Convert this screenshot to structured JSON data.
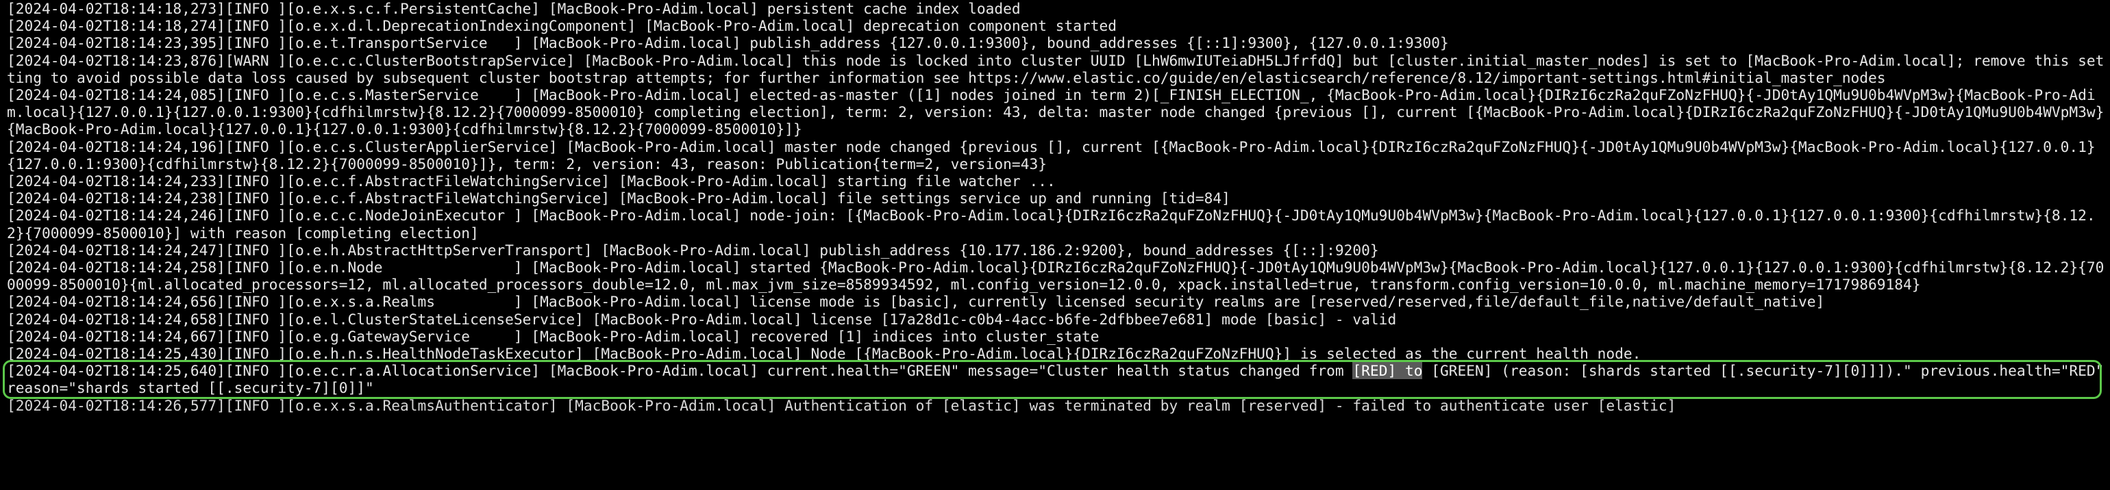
{
  "log": {
    "lines": [
      "[2024-04-02T18:14:18,273][INFO ][o.e.x.s.c.f.PersistentCache] [MacBook-Pro-Adim.local] persistent cache index loaded",
      "[2024-04-02T18:14:18,274][INFO ][o.e.x.d.l.DeprecationIndexingComponent] [MacBook-Pro-Adim.local] deprecation component started",
      "[2024-04-02T18:14:23,395][INFO ][o.e.t.TransportService   ] [MacBook-Pro-Adim.local] publish_address {127.0.0.1:9300}, bound_addresses {[::1]:9300}, {127.0.0.1:9300}",
      "[2024-04-02T18:14:23,876][WARN ][o.e.c.c.ClusterBootstrapService] [MacBook-Pro-Adim.local] this node is locked into cluster UUID [LhW6mwIUTeiaDH5LJfrfdQ] but [cluster.initial_master_nodes] is set to [MacBook-Pro-Adim.local]; remove this setting to avoid possible data loss caused by subsequent cluster bootstrap attempts; for further information see https://www.elastic.co/guide/en/elasticsearch/reference/8.12/important-settings.html#initial_master_nodes",
      "[2024-04-02T18:14:24,085][INFO ][o.e.c.s.MasterService    ] [MacBook-Pro-Adim.local] elected-as-master ([1] nodes joined in term 2)[_FINISH_ELECTION_, {MacBook-Pro-Adim.local}{DIRzI6czRa2quFZoNzFHUQ}{-JD0tAy1QMu9U0b4WVpM3w}{MacBook-Pro-Adim.local}{127.0.0.1}{127.0.0.1:9300}{cdfhilmrstw}{8.12.2}{7000099-8500010} completing election], term: 2, version: 43, delta: master node changed {previous [], current [{MacBook-Pro-Adim.local}{DIRzI6czRa2quFZoNzFHUQ}{-JD0tAy1QMu9U0b4WVpM3w}{MacBook-Pro-Adim.local}{127.0.0.1}{127.0.0.1:9300}{cdfhilmrstw}{8.12.2}{7000099-8500010}]}",
      "[2024-04-02T18:14:24,196][INFO ][o.e.c.s.ClusterApplierService] [MacBook-Pro-Adim.local] master node changed {previous [], current [{MacBook-Pro-Adim.local}{DIRzI6czRa2quFZoNzFHUQ}{-JD0tAy1QMu9U0b4WVpM3w}{MacBook-Pro-Adim.local}{127.0.0.1}{127.0.0.1:9300}{cdfhilmrstw}{8.12.2}{7000099-8500010}]}, term: 2, version: 43, reason: Publication{term=2, version=43}",
      "[2024-04-02T18:14:24,233][INFO ][o.e.c.f.AbstractFileWatchingService] [MacBook-Pro-Adim.local] starting file watcher ...",
      "[2024-04-02T18:14:24,238][INFO ][o.e.c.f.AbstractFileWatchingService] [MacBook-Pro-Adim.local] file settings service up and running [tid=84]",
      "[2024-04-02T18:14:24,246][INFO ][o.e.c.c.NodeJoinExecutor ] [MacBook-Pro-Adim.local] node-join: [{MacBook-Pro-Adim.local}{DIRzI6czRa2quFZoNzFHUQ}{-JD0tAy1QMu9U0b4WVpM3w}{MacBook-Pro-Adim.local}{127.0.0.1}{127.0.0.1:9300}{cdfhilmrstw}{8.12.2}{7000099-8500010}] with reason [completing election]",
      "[2024-04-02T18:14:24,247][INFO ][o.e.h.AbstractHttpServerTransport] [MacBook-Pro-Adim.local] publish_address {10.177.186.2:9200}, bound_addresses {[::]:9200}",
      "[2024-04-02T18:14:24,258][INFO ][o.e.n.Node               ] [MacBook-Pro-Adim.local] started {MacBook-Pro-Adim.local}{DIRzI6czRa2quFZoNzFHUQ}{-JD0tAy1QMu9U0b4WVpM3w}{MacBook-Pro-Adim.local}{127.0.0.1}{127.0.0.1:9300}{cdfhilmrstw}{8.12.2}{7000099-8500010}{ml.allocated_processors=12, ml.allocated_processors_double=12.0, ml.max_jvm_size=8589934592, ml.config_version=12.0.0, xpack.installed=true, transform.config_version=10.0.0, ml.machine_memory=17179869184}",
      "[2024-04-02T18:14:24,656][INFO ][o.e.x.s.a.Realms         ] [MacBook-Pro-Adim.local] license mode is [basic], currently licensed security realms are [reserved/reserved,file/default_file,native/default_native]",
      "[2024-04-02T18:14:24,658][INFO ][o.e.l.ClusterStateLicenseService] [MacBook-Pro-Adim.local] license [17a28d1c-c0b4-4acc-b6fe-2dfbbee7e681] mode [basic] - valid",
      "[2024-04-02T18:14:24,667][INFO ][o.e.g.GatewayService     ] [MacBook-Pro-Adim.local] recovered [1] indices into cluster_state",
      "[2024-04-02T18:14:25,430][INFO ][o.e.h.n.s.HealthNodeTaskExecutor] [MacBook-Pro-Adim.local] Node [{MacBook-Pro-Adim.local}{DIRzI6czRa2quFZoNzFHUQ}] is selected as the current health node."
    ],
    "highlighted_line": {
      "before": "[2024-04-02T18:14:25,640][INFO ][o.e.c.r.a.AllocationService] [MacBook-Pro-Adim.local] current.health=\"GREEN\" message=\"Cluster health status changed from ",
      "selected": "[RED] to",
      "after": " [GREEN] (reason: [shards started [[.security-7][0]]]).\" previous.health=\"RED\" reason=\"shards started [[.security-7][0]]\""
    },
    "tail_line": "[2024-04-02T18:14:26,577][INFO ][o.e.x.s.a.RealmsAuthenticator] [MacBook-Pro-Adim.local] Authentication of [elastic] was terminated by realm [reserved] - failed to authenticate user [elastic]"
  },
  "colors": {
    "background": "#000000",
    "text": "#e6e6e6",
    "highlight_border": "#5cc94a",
    "selection": "#5a5a5a"
  }
}
